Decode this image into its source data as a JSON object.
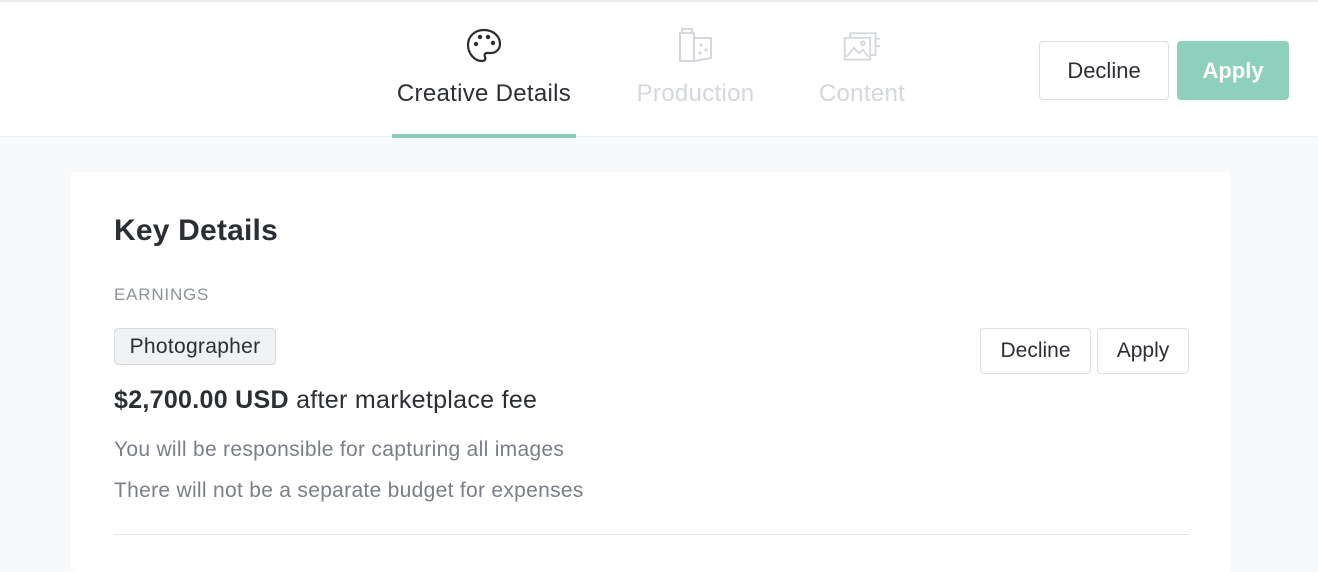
{
  "tabs": [
    {
      "label": "Creative Details",
      "icon": "palette-icon",
      "active": true
    },
    {
      "label": "Production",
      "icon": "production-icon",
      "active": false
    },
    {
      "label": "Content",
      "icon": "image-gallery-icon",
      "active": false
    }
  ],
  "header_actions": {
    "decline_label": "Decline",
    "apply_label": "Apply"
  },
  "key_details": {
    "title": "Key Details",
    "section_label": "EARNINGS",
    "role": "Photographer",
    "amount": "$2,700.00 USD",
    "amount_suffix": " after marketplace fee",
    "notes": [
      "You will be responsible for capturing all images",
      "There will not be a separate budget for expenses"
    ],
    "decline_label": "Decline",
    "apply_label": "Apply"
  },
  "colors": {
    "accent": "#86cdb7",
    "apply_button": "#8dd0bb",
    "inactive_tab": "#d4d7dc",
    "background": "#f8f9fa"
  }
}
